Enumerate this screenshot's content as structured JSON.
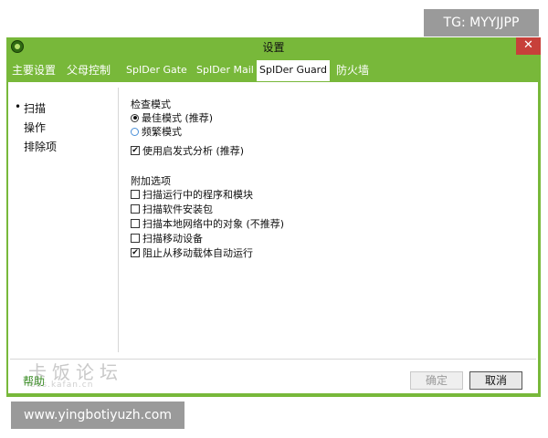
{
  "overlays": {
    "tg_label": "TG: MYYJJPP",
    "url_label": "www.yingbotiyuzh.com"
  },
  "window": {
    "title": "设置",
    "close_glyph": "✕",
    "accent_color": "#78b83a"
  },
  "tabs": [
    {
      "label": "主要设置"
    },
    {
      "label": "父母控制"
    },
    {
      "label": "SpIDer Gate"
    },
    {
      "label": "SpIDer Mail"
    },
    {
      "label": "SpIDer Guard"
    },
    {
      "label": "防火墙"
    }
  ],
  "active_tab": "SpIDer Guard",
  "sidebar": {
    "bullet": "•",
    "items": [
      {
        "label": "扫描",
        "selected": true
      },
      {
        "label": "操作",
        "selected": false
      },
      {
        "label": "排除项",
        "selected": false
      }
    ]
  },
  "scan": {
    "mode_title": "检查模式",
    "mode_options": [
      {
        "label": "最佳模式 (推荐)",
        "selected": true
      },
      {
        "label": "频繁模式",
        "selected": false
      }
    ],
    "heuristic": {
      "label": "使用启发式分析 (推荐)",
      "checked": true
    },
    "extra_title": "附加选项",
    "extra_options": [
      {
        "label": "扫描运行中的程序和模块",
        "checked": false
      },
      {
        "label": "扫描软件安装包",
        "checked": false
      },
      {
        "label": "扫描本地网络中的对象 (不推荐)",
        "checked": false
      },
      {
        "label": "扫描移动设备",
        "checked": false
      },
      {
        "label": "阻止从移动载体自动运行",
        "checked": true
      }
    ]
  },
  "footer": {
    "help_label": "帮助",
    "ok_label": "确定",
    "cancel_label": "取消",
    "watermark": "卡饭论坛",
    "watermark_sub": "bbs.kafan.cn",
    "check_glyph": "✔"
  }
}
